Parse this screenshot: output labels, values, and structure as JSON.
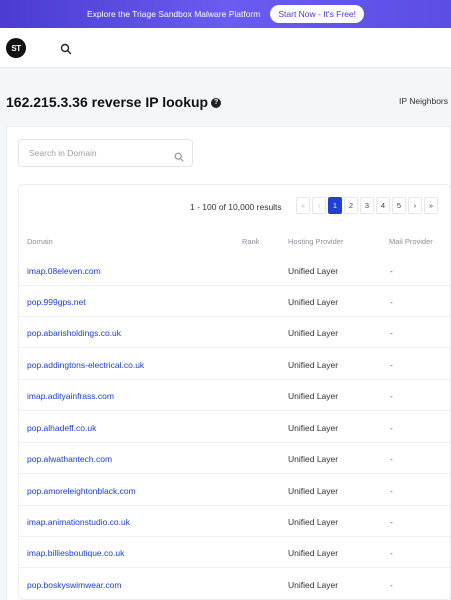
{
  "banner": {
    "text": "Explore the Triage Sandbox Malware Platform",
    "cta": "Start Now - It's Free!"
  },
  "header": {
    "logo_text": "ST",
    "icons": [
      "logo",
      "search-icon"
    ]
  },
  "page": {
    "title": "162.215.3.36 reverse IP lookup",
    "help_icon": "?",
    "ip_neighbors_link": "IP Neighbors"
  },
  "search": {
    "placeholder": "Search in Domain"
  },
  "results": {
    "summary": "1 - 100 of 10,000 results",
    "pagination": [
      "«",
      "‹",
      "1",
      "2",
      "3",
      "4",
      "5",
      "›",
      "»"
    ],
    "current_page": "1"
  },
  "table": {
    "columns": [
      "Domain",
      "Rank",
      "Hosting Provider",
      "Mail Provider"
    ],
    "rows": [
      {
        "domain": "imap.08eleven.com",
        "rank": "",
        "hosting": "Unified Layer",
        "mail": "-"
      },
      {
        "domain": "pop.999gps.net",
        "rank": "",
        "hosting": "Unified Layer",
        "mail": "-"
      },
      {
        "domain": "pop.abarisholdings.co.uk",
        "rank": "",
        "hosting": "Unified Layer",
        "mail": "-"
      },
      {
        "domain": "pop.addingtons-electrical.co.uk",
        "rank": "",
        "hosting": "Unified Layer",
        "mail": "-"
      },
      {
        "domain": "imap.adityainfrass.com",
        "rank": "",
        "hosting": "Unified Layer",
        "mail": "-"
      },
      {
        "domain": "pop.alhadeff.co.uk",
        "rank": "",
        "hosting": "Unified Layer",
        "mail": "-"
      },
      {
        "domain": "pop.alwathantech.com",
        "rank": "",
        "hosting": "Unified Layer",
        "mail": "-"
      },
      {
        "domain": "pop.amoreleightonblack.com",
        "rank": "",
        "hosting": "Unified Layer",
        "mail": "-"
      },
      {
        "domain": "imap.animationstudio.co.uk",
        "rank": "",
        "hosting": "Unified Layer",
        "mail": "-"
      },
      {
        "domain": "imap.billiesboutique.co.uk",
        "rank": "",
        "hosting": "Unified Layer",
        "mail": "-"
      },
      {
        "domain": "pop.boskyswimwear.com",
        "rank": "",
        "hosting": "Unified Layer",
        "mail": "-"
      }
    ]
  },
  "colors": {
    "banner_bg": "#5b4ee4",
    "link": "#1d3ecf",
    "active_page": "#1f3fd6"
  }
}
